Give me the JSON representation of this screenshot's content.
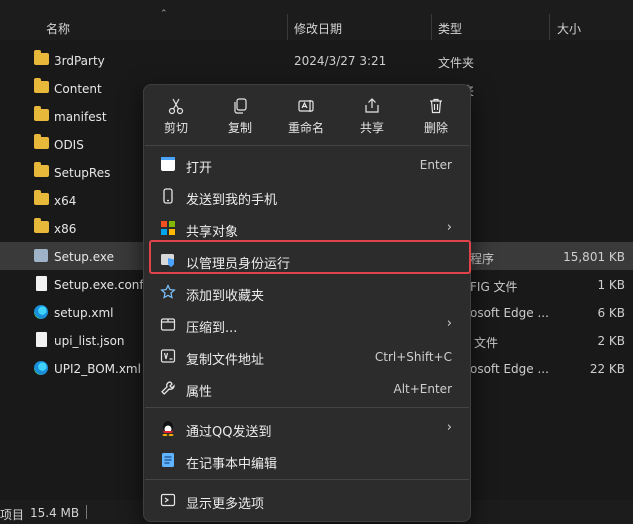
{
  "columns": {
    "name": "名称",
    "date": "修改日期",
    "type": "类型",
    "size": "大小"
  },
  "files": [
    {
      "name": "3rdParty",
      "date": "2024/3/27 3:21",
      "type": "文件夹",
      "size": "",
      "icon": "folder-icon"
    },
    {
      "name": "Content",
      "date": "",
      "type": "文件夹",
      "size": "",
      "icon": "folder-icon"
    },
    {
      "name": "manifest",
      "date": "",
      "type": "",
      "size": "",
      "icon": "folder-icon"
    },
    {
      "name": "ODIS",
      "date": "",
      "type": "",
      "size": "",
      "icon": "folder-icon"
    },
    {
      "name": "SetupRes",
      "date": "",
      "type": "",
      "size": "",
      "icon": "folder-icon"
    },
    {
      "name": "x64",
      "date": "",
      "type": "",
      "size": "",
      "icon": "folder-icon"
    },
    {
      "name": "x86",
      "date": "",
      "type": "",
      "size": "",
      "icon": "folder-icon"
    },
    {
      "name": "Setup.exe",
      "date": "",
      "type": "程序",
      "size": "15,801 KB",
      "icon": "exe-icon"
    },
    {
      "name": "Setup.exe.config",
      "date": "",
      "type": "FIG 文件",
      "size": "1 KB",
      "icon": "document-icon"
    },
    {
      "name": "setup.xml",
      "date": "",
      "type": "osoft Edge ...",
      "size": "6 KB",
      "icon": "edge-icon"
    },
    {
      "name": "upi_list.json",
      "date": "",
      "type": "文件",
      "size": "2 KB",
      "icon": "document-icon"
    },
    {
      "name": "UPI2_BOM.xml",
      "date": "",
      "type": "osoft Edge ...",
      "size": "22 KB",
      "icon": "edge-icon"
    }
  ],
  "status": {
    "items_label": "项目",
    "selection_size": "15.4 MB"
  },
  "context_menu": {
    "toolbar": [
      {
        "label": "剪切",
        "icon": "scissors-icon"
      },
      {
        "label": "复制",
        "icon": "copy-icon"
      },
      {
        "label": "重命名",
        "icon": "rename-icon"
      },
      {
        "label": "共享",
        "icon": "share-icon"
      },
      {
        "label": "删除",
        "icon": "trash-icon"
      }
    ],
    "items": [
      {
        "label": "打开",
        "shortcut": "Enter",
        "icon": "open-icon"
      },
      {
        "label": "发送到我的手机",
        "shortcut": "",
        "icon": "phone-icon"
      },
      {
        "label": "共享对象",
        "shortcut": "",
        "icon": "share-object-icon",
        "submenu": true
      },
      {
        "label": "以管理员身份运行",
        "shortcut": "",
        "icon": "shield-icon"
      },
      {
        "label": "添加到收藏夹",
        "shortcut": "",
        "icon": "star-icon"
      },
      {
        "label": "压缩到...",
        "shortcut": "",
        "icon": "zip-icon",
        "submenu": true
      },
      {
        "label": "复制文件地址",
        "shortcut": "Ctrl+Shift+C",
        "icon": "copy-path-icon"
      },
      {
        "label": "属性",
        "shortcut": "Alt+Enter",
        "icon": "wrench-icon"
      },
      {
        "label": "通过QQ发送到",
        "shortcut": "",
        "icon": "qq-icon",
        "submenu": true
      },
      {
        "label": "在记事本中编辑",
        "shortcut": "",
        "icon": "notepad-icon"
      },
      {
        "label": "显示更多选项",
        "shortcut": "",
        "icon": "more-options-icon"
      }
    ],
    "submenu_arrow": "›"
  },
  "colors": {
    "highlight": "#e0434a",
    "folder": "#e8b83a",
    "accent": "#4aa3ff"
  }
}
